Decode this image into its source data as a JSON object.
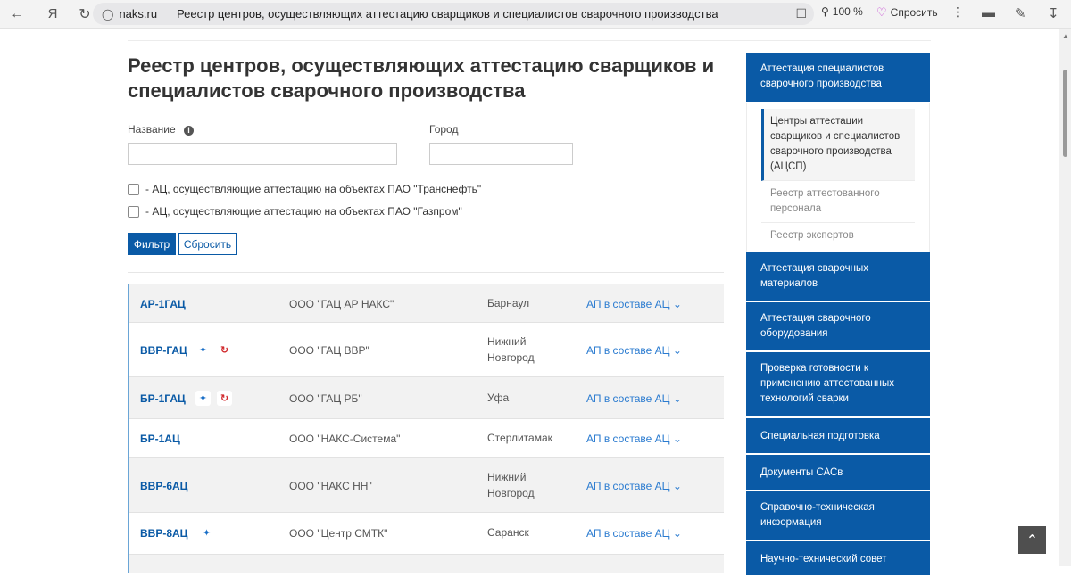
{
  "browser": {
    "host": "naks.ru",
    "tab_title": "Реестр центров, осуществляющих аттестацию сварщиков и специалистов сварочного производства",
    "zoom": "100 %",
    "ask_label": "Спросить"
  },
  "page": {
    "title": "Реестр центров, осуществляющих аттестацию сварщиков и специалистов сварочного производства"
  },
  "filters": {
    "name_label": "Название",
    "city_label": "Город",
    "name_value": "",
    "city_value": "",
    "checkbox_transneft": "- АЦ, осуществляющие аттестацию на объектах ПАО \"Транснефть\"",
    "checkbox_gazprom": "- АЦ, осуществляющие аттестацию на объектах ПАО \"Газпром\"",
    "filter_button": "Фильтр",
    "reset_button": "Сбросить"
  },
  "rows": [
    {
      "code": "АР-1ГАЦ",
      "org": "ООО \"ГАЦ АР НАКС\"",
      "city": "Барнаул",
      "ap": "АП в составе АЦ",
      "gazprom": false,
      "transneft": false
    },
    {
      "code": "ВВР-ГАЦ",
      "org": "ООО \"ГАЦ ВВР\"",
      "city": "Нижний Новгород",
      "ap": "АП в составе АЦ",
      "gazprom": true,
      "transneft": true
    },
    {
      "code": "БР-1ГАЦ",
      "org": "ООО \"ГАЦ РБ\"",
      "city": "Уфа",
      "ap": "АП в составе АЦ",
      "gazprom": true,
      "transneft": true
    },
    {
      "code": "БР-1АЦ",
      "org": "ООО \"НАКС-Система\"",
      "city": "Стерлитамак",
      "ap": "АП в составе АЦ",
      "gazprom": false,
      "transneft": false
    },
    {
      "code": "ВВР-6АЦ",
      "org": "ООО \"НАКС НН\"",
      "city": "Нижний Новгород",
      "ap": "АП в составе АЦ",
      "gazprom": false,
      "transneft": false
    },
    {
      "code": "ВВР-8АЦ",
      "org": "ООО \"Центр СМТК\"",
      "city": "Саранск",
      "ap": "АП в составе АЦ",
      "gazprom": true,
      "transneft": false
    }
  ],
  "sidebar": {
    "section_1": "Аттестация специалистов сварочного производства",
    "sub_1": "Центры аттестации сварщиков и специалистов сварочного производства (АЦСП)",
    "sub_2": "Реестр аттестованного персонала",
    "sub_3": "Реестр экспертов",
    "section_2": "Аттестация сварочных материалов",
    "section_3": "Аттестация сварочного оборудования",
    "section_4": "Проверка готовности к применению аттестованных технологий сварки",
    "section_5": "Специальная подготовка",
    "section_6": "Документы САСв",
    "section_7": "Справочно-техническая информация",
    "section_8": "Научно-технический совет"
  },
  "colors": {
    "brand_blue": "#0a5aa6",
    "link_blue": "#2a7bd0"
  },
  "icons": [
    "back-arrow-icon",
    "yandex-icon",
    "reload-icon",
    "shield-icon",
    "bookmark-icon",
    "zoom-icon",
    "chevron-down-icon",
    "gazprom-icon",
    "transneft-icon",
    "scroll-top-icon"
  ]
}
